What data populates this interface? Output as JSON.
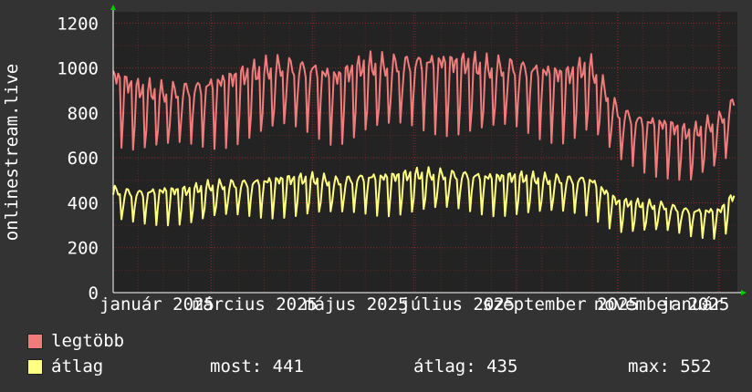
{
  "chart_data": {
    "type": "line",
    "ylabel": "onlinestream.live",
    "ylim": [
      0,
      1250
    ],
    "yticks": [
      0,
      200,
      400,
      600,
      800,
      1000,
      1200
    ],
    "xlim": [
      "2025-01-01",
      "2026-01-12"
    ],
    "xticks": [
      {
        "label": "január 2025",
        "date": "2025-01-01"
      },
      {
        "label": "március 2025",
        "date": "2025-03-01"
      },
      {
        "label": "május 2025",
        "date": "2025-05-01"
      },
      {
        "label": "július 2025",
        "date": "2025-07-01"
      },
      {
        "label": "szeptember 2025",
        "date": "2025-09-01"
      },
      {
        "label": "november 2025",
        "date": "2025-11-01"
      },
      {
        "label": "január",
        "date": "2026-01-01"
      }
    ],
    "grid": true,
    "colors": {
      "background": "#333333",
      "plot_background": "#232323",
      "grid": "#8c2a2a",
      "axis": "#ffffff",
      "tick_text": "#ffffff",
      "arrow": "#00cc00"
    },
    "series": [
      {
        "name": "legtöbb",
        "color": "#f27b7b",
        "x": [
          "2025-01-01",
          "2025-01-15",
          "2025-02-01",
          "2025-02-15",
          "2025-03-01",
          "2025-03-15",
          "2025-04-01",
          "2025-04-15",
          "2025-05-01",
          "2025-05-15",
          "2025-06-01",
          "2025-06-15",
          "2025-07-01",
          "2025-07-15",
          "2025-08-01",
          "2025-08-15",
          "2025-09-01",
          "2025-09-15",
          "2025-10-01",
          "2025-10-15",
          "2025-11-01",
          "2025-11-15",
          "2025-12-01",
          "2025-12-15",
          "2026-01-01",
          "2026-01-10"
        ],
        "values": [
          960,
          900,
          880,
          900,
          920,
          950,
          980,
          1000,
          990,
          950,
          1000,
          1000,
          1020,
          1020,
          1010,
          990,
          1000,
          980,
          960,
          1000,
          800,
          760,
          740,
          700,
          760,
          840
        ]
      },
      {
        "name": "átlag",
        "color": "#ffff80",
        "x": [
          "2025-01-01",
          "2025-01-15",
          "2025-02-01",
          "2025-02-15",
          "2025-03-01",
          "2025-03-15",
          "2025-04-01",
          "2025-04-15",
          "2025-05-01",
          "2025-05-15",
          "2025-06-01",
          "2025-06-15",
          "2025-07-01",
          "2025-07-15",
          "2025-08-01",
          "2025-08-15",
          "2025-09-01",
          "2025-09-15",
          "2025-10-01",
          "2025-10-15",
          "2025-11-01",
          "2025-11-15",
          "2025-12-01",
          "2025-12-15",
          "2026-01-01",
          "2026-01-10"
        ],
        "values": [
          450,
          440,
          450,
          450,
          470,
          480,
          490,
          500,
          500,
          490,
          510,
          510,
          520,
          520,
          520,
          510,
          510,
          500,
          500,
          500,
          400,
          390,
          380,
          360,
          360,
          430
        ]
      }
    ],
    "legend": {
      "placement": "bottom-left",
      "items": [
        {
          "label": "legtöbb",
          "color": "#f27b7b"
        },
        {
          "label": "átlag",
          "color": "#ffff80"
        }
      ]
    },
    "stats": {
      "most": "most: 441",
      "atlag": "átlag: 435",
      "max": "max: 552"
    }
  }
}
